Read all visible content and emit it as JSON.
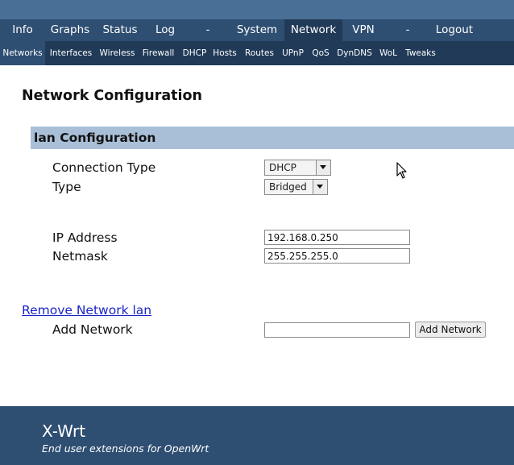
{
  "main_nav": {
    "items": [
      {
        "label": "Info"
      },
      {
        "label": "Graphs"
      },
      {
        "label": "Status"
      },
      {
        "label": "Log"
      },
      {
        "label": "-"
      },
      {
        "label": "System"
      },
      {
        "label": "Network",
        "active": true
      },
      {
        "label": "VPN"
      },
      {
        "label": "-"
      },
      {
        "label": "Logout"
      }
    ]
  },
  "sub_nav": {
    "items": [
      {
        "label": "Networks",
        "active": true
      },
      {
        "label": "Interfaces"
      },
      {
        "label": "Wireless"
      },
      {
        "label": "Firewall"
      },
      {
        "label": "DHCP"
      },
      {
        "label": "Hosts"
      },
      {
        "label": "Routes"
      },
      {
        "label": "UPnP"
      },
      {
        "label": "QoS"
      },
      {
        "label": "DynDNS"
      },
      {
        "label": "WoL"
      },
      {
        "label": "Tweaks"
      }
    ]
  },
  "page": {
    "title": "Network Configuration",
    "section_title": "lan Configuration",
    "connection_type_label": "Connection Type",
    "connection_type_value": "DHCP",
    "type_label": "Type",
    "type_value": "Bridged",
    "ip_label": "IP Address",
    "ip_value": "192.168.0.250",
    "netmask_label": "Netmask",
    "netmask_value": "255.255.255.0",
    "remove_link": "Remove Network lan",
    "add_label": "Add Network",
    "add_value": "",
    "add_button": "Add Network"
  },
  "footer": {
    "title": "X-Wrt",
    "subtitle": "End user extensions for OpenWrt"
  },
  "colors": {
    "top_strip": "#4a6f96",
    "nav_bg": "#2e4e72",
    "nav_active": "#203a58",
    "section_bar": "#a9bfd7",
    "link": "#1a24c9"
  }
}
